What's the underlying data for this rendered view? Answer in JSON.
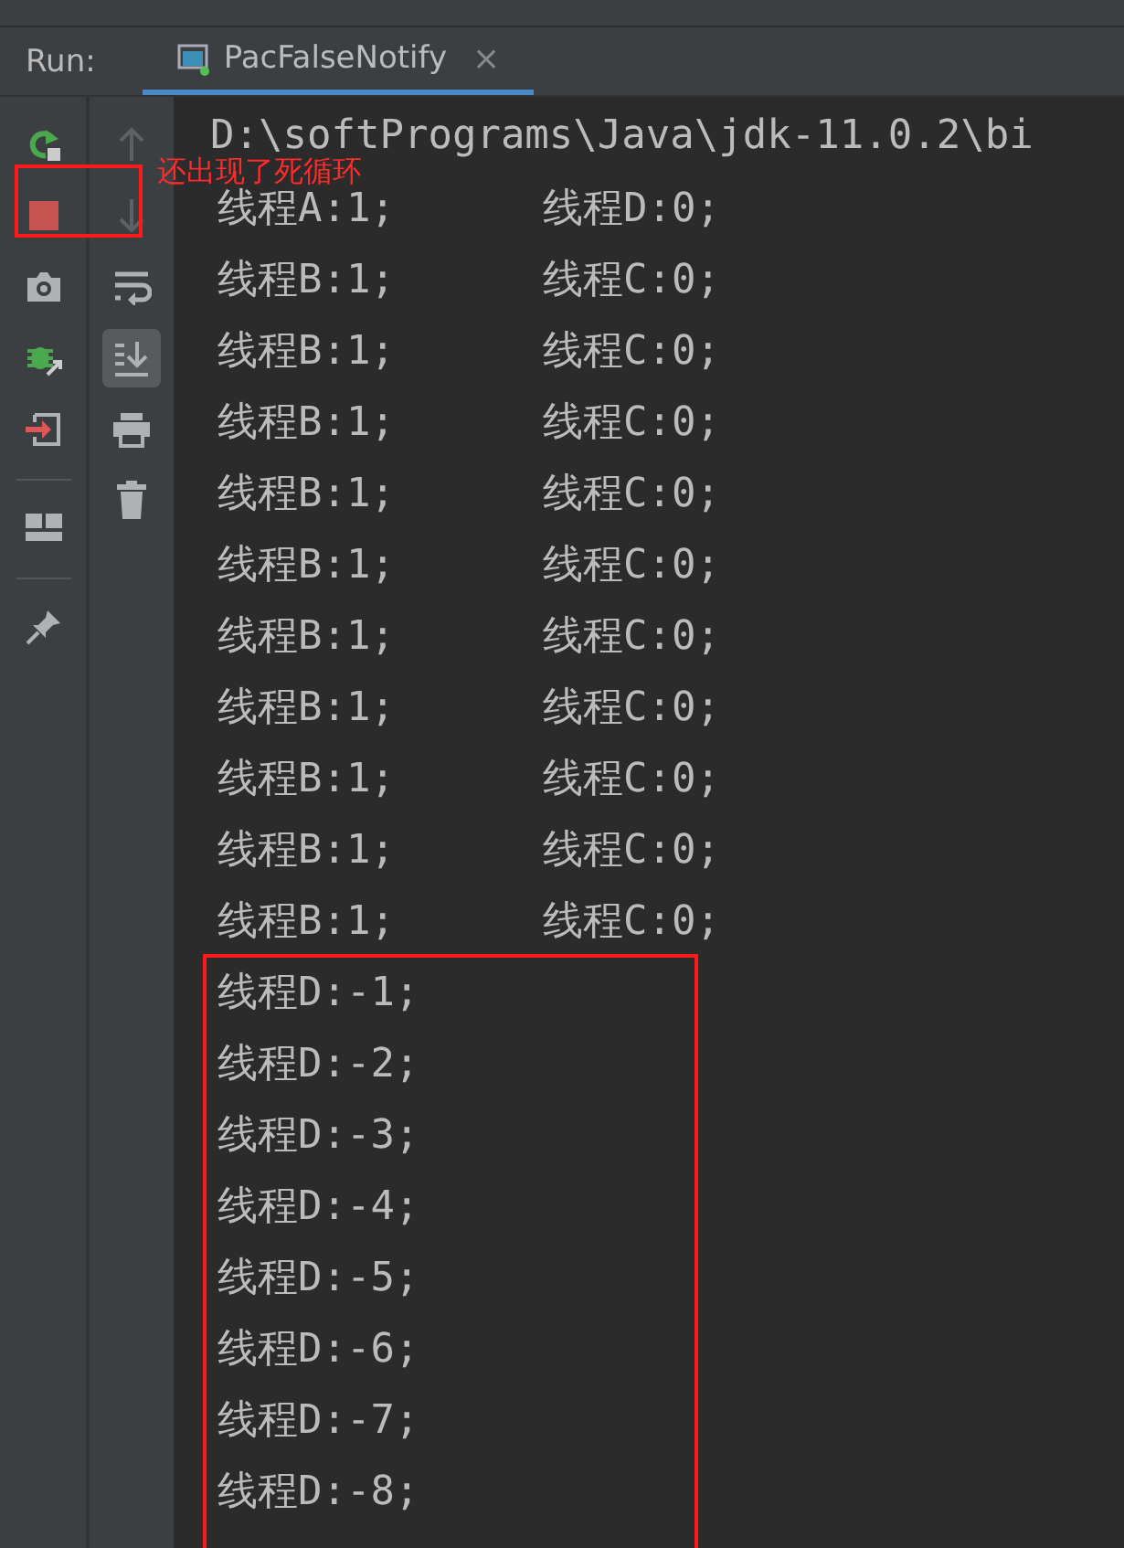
{
  "run_tab": {
    "label": "Run:",
    "tab": {
      "title": "PacFalseNotify",
      "close": "×",
      "selected": true
    }
  },
  "left_toolbar": [
    {
      "kind": "rerun"
    },
    {
      "kind": "stop"
    },
    {
      "kind": "camera"
    },
    {
      "kind": "debug"
    },
    {
      "kind": "exit"
    },
    {
      "kind": "separator"
    },
    {
      "kind": "layout"
    },
    {
      "kind": "separator"
    },
    {
      "kind": "pin"
    }
  ],
  "right_toolbar": [
    {
      "kind": "up",
      "disabled": true,
      "selected": false
    },
    {
      "kind": "down",
      "disabled": true,
      "selected": false
    },
    {
      "kind": "wrap",
      "disabled": false,
      "selected": false
    },
    {
      "kind": "scroll-end",
      "disabled": false,
      "selected": true
    },
    {
      "kind": "print",
      "disabled": false,
      "selected": false
    },
    {
      "kind": "trash",
      "disabled": false,
      "selected": false
    }
  ],
  "console": {
    "command": "D:\\softPrograms\\Java\\jdk-11.0.2\\bi",
    "lines": [
      {
        "column_1": "线程A:1;",
        "column_2": "线程D:0;"
      },
      {
        "column_1": "线程B:1;",
        "column_2": "线程C:0;"
      },
      {
        "column_1": "线程B:1;",
        "column_2": "线程C:0;"
      },
      {
        "column_1": "线程B:1;",
        "column_2": "线程C:0;"
      },
      {
        "column_1": "线程B:1;",
        "column_2": "线程C:0;"
      },
      {
        "column_1": "线程B:1;",
        "column_2": "线程C:0;"
      },
      {
        "column_1": "线程B:1;",
        "column_2": "线程C:0;"
      },
      {
        "column_1": "线程B:1;",
        "column_2": "线程C:0;"
      },
      {
        "column_1": "线程B:1;",
        "column_2": "线程C:0;"
      },
      {
        "column_1": "线程B:1;",
        "column_2": "线程C:0;"
      },
      {
        "column_1": "线程B:1;",
        "column_2": "线程C:0;"
      },
      {
        "column_1": "线程D:-1;"
      },
      {
        "column_1": "线程D:-2;"
      },
      {
        "column_1": "线程D:-3;"
      },
      {
        "column_1": "线程D:-4;"
      },
      {
        "column_1": "线程D:-5;"
      },
      {
        "column_1": "线程D:-6;"
      },
      {
        "column_1": "线程D:-7;"
      },
      {
        "column_1": "线程D:-8;"
      }
    ]
  },
  "annotations": [
    {
      "kind": "stop-box"
    },
    {
      "kind": "text",
      "text": "还出现了死循环"
    },
    {
      "kind": "lines-box"
    }
  ]
}
